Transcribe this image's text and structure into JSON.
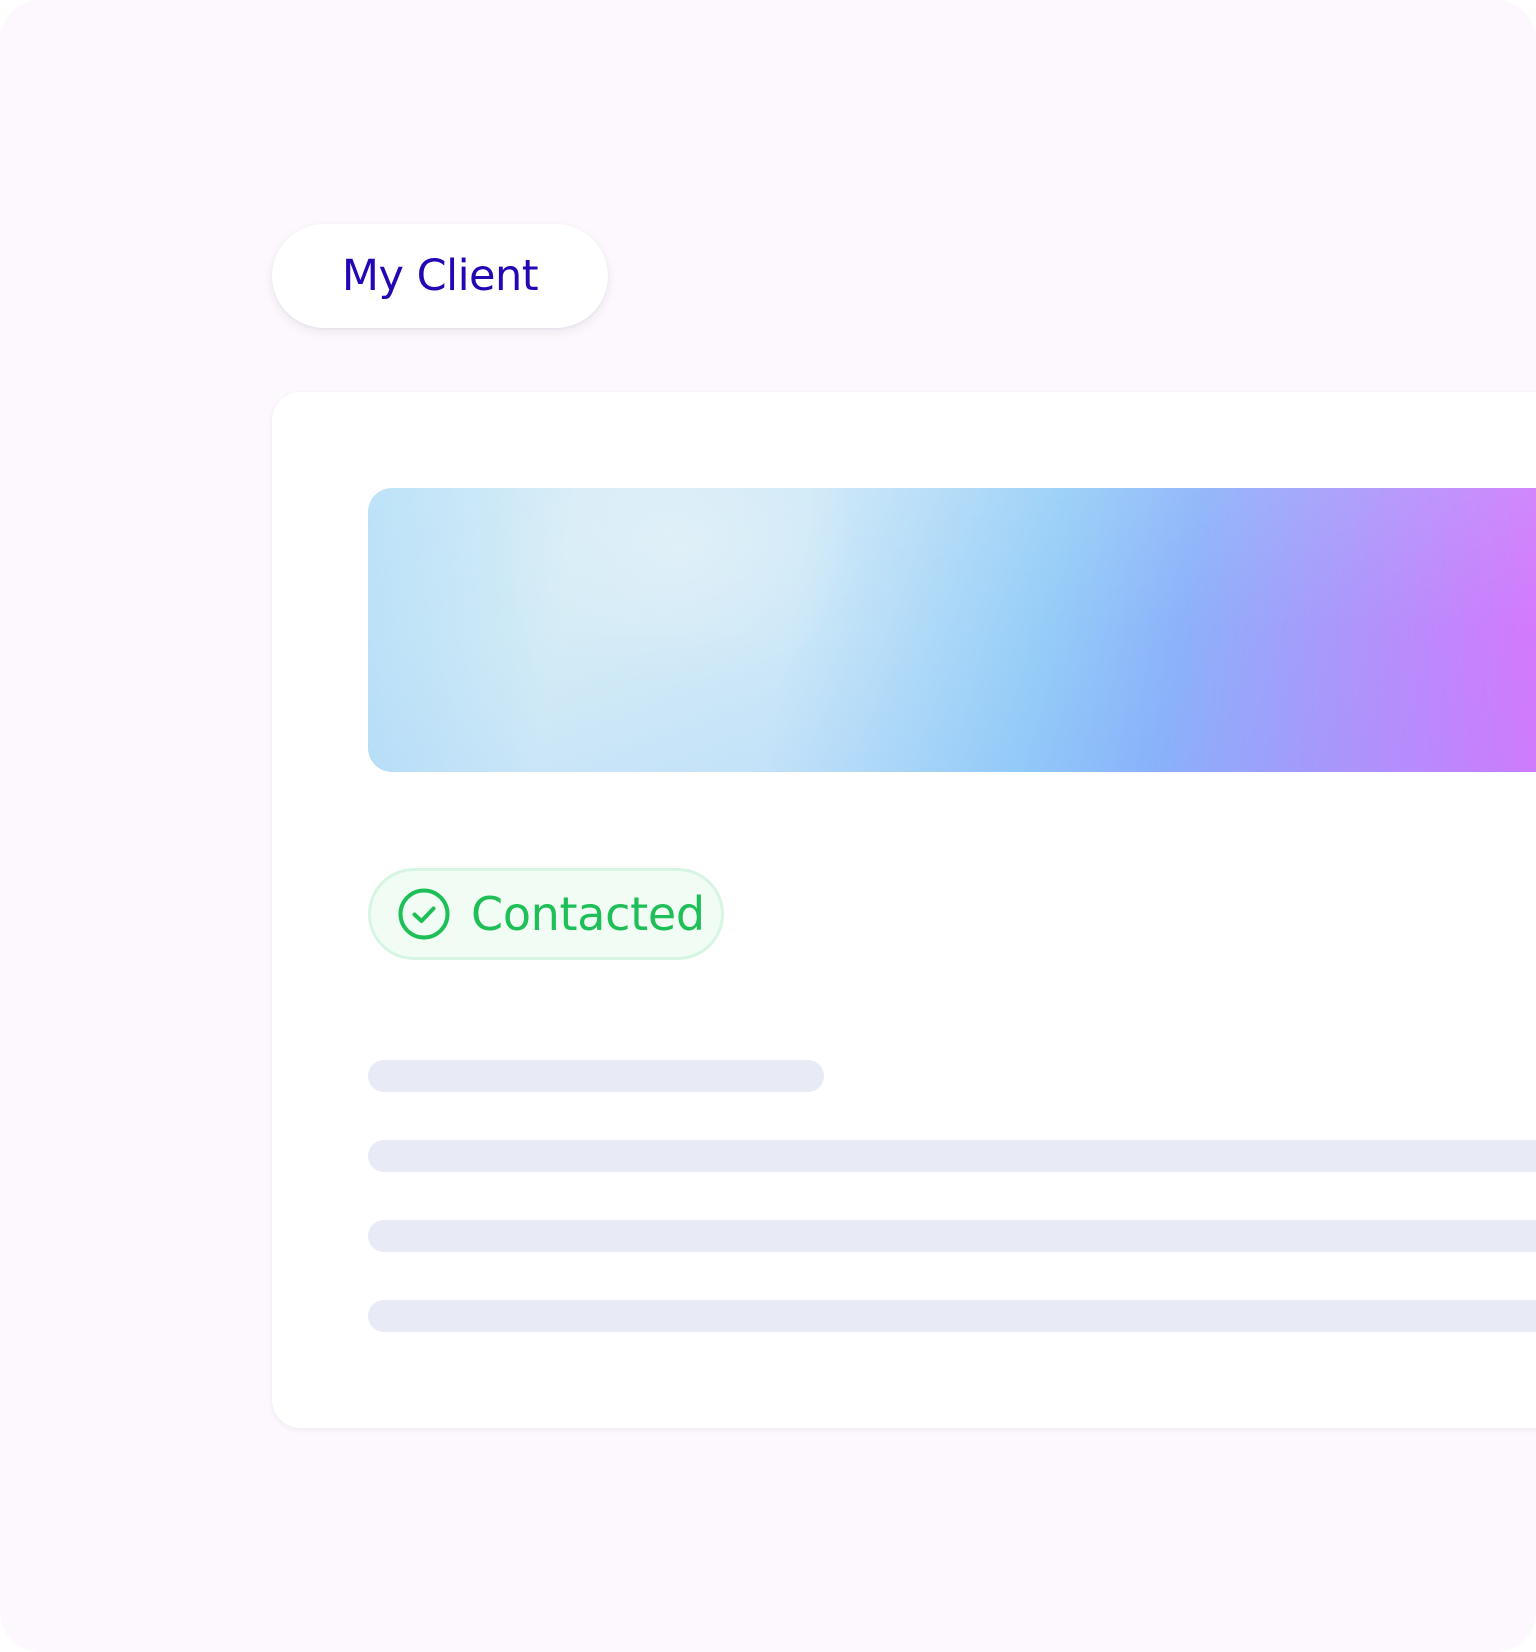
{
  "client_tab": {
    "label": "My Client"
  },
  "card": {
    "banner": {
      "gradient_colors": [
        "#b8e0f8",
        "#d4ecf6",
        "#95cdf8",
        "#a69bfb",
        "#f566fb"
      ]
    },
    "status": {
      "label": "Contacted",
      "icon": "check-circle-icon",
      "color": "#1fbf57"
    },
    "placeholder_lines": 4
  },
  "colors": {
    "background": "#fdf8fd",
    "tab_text": "#2406b5",
    "skeleton": "#e8eaf5"
  }
}
